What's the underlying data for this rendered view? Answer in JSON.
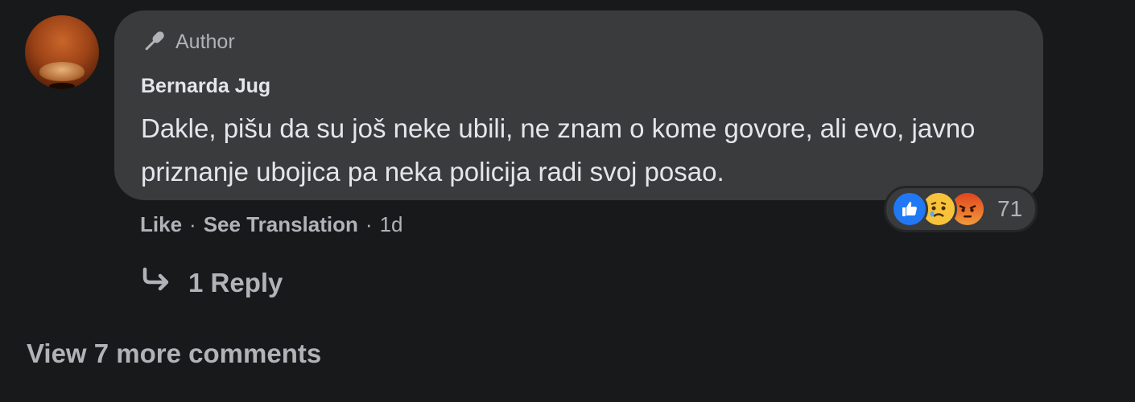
{
  "comment": {
    "author_badge": "Author",
    "name": "Bernarda Jug",
    "text": "Dakle, pišu da su još neke ubili, ne znam o kome govore, ali evo, javno priznanje ubojica pa neka policija radi svoj posao.",
    "reactions": {
      "icons": [
        "like-icon",
        "sad-icon",
        "angry-icon"
      ],
      "count": "71"
    },
    "actions": {
      "like": "Like",
      "sep": "·",
      "translate": "See Translation",
      "time": "1d"
    },
    "replies": "1 Reply"
  },
  "view_more": "View 7 more comments",
  "colors": {
    "background": "#18191a",
    "bubble": "#3a3b3c",
    "primary_text": "#e4e6eb",
    "secondary_text": "#b0b3b8",
    "like_blue": "#2078f4"
  }
}
